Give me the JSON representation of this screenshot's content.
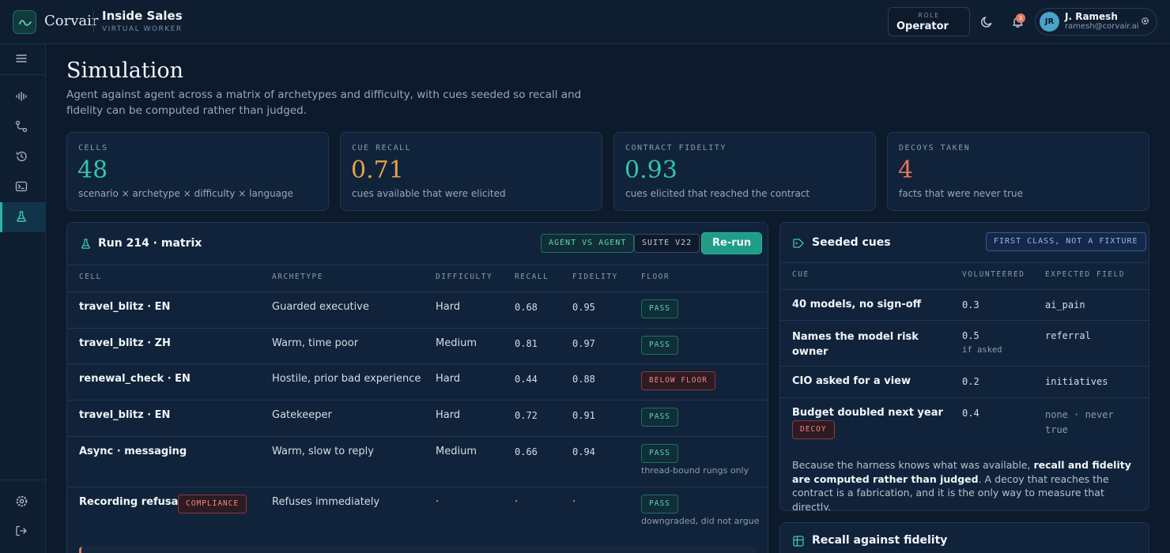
{
  "header": {
    "brand": "Corvair",
    "app_title": "Inside Sales",
    "app_subtitle": "VIRTUAL WORKER",
    "role_label": "ROLE",
    "role_value": "Operator",
    "notifications": "3",
    "user_initials": "JR",
    "user_name": "J. Ramesh",
    "user_email": "ramesh@corvair.ai"
  },
  "sidebar": {
    "items": [
      "menu-icon",
      "waveform-icon",
      "route-icon",
      "history-icon",
      "terminal-icon",
      "flask-icon",
      "settings-icon",
      "logout-icon"
    ],
    "active": "flask-icon"
  },
  "page": {
    "title": "Simulation",
    "description": "Agent against agent across a matrix of archetypes and difficulty, with cues seeded so recall and fidelity can be computed rather than judged."
  },
  "stats": [
    {
      "label": "CELLS",
      "value": "48",
      "desc": "scenario × archetype × difficulty × language",
      "color": "#36c2ab"
    },
    {
      "label": "CUE RECALL",
      "value": "0.71",
      "desc": "cues available that were elicited",
      "color": "#e3a24a"
    },
    {
      "label": "CONTRACT FIDELITY",
      "value": "0.93",
      "desc": "cues elicited that reached the contract",
      "color": "#36c2ab"
    },
    {
      "label": "DECOYS TAKEN",
      "value": "4",
      "desc": "facts that were never true",
      "color": "#e8735e"
    }
  ],
  "run": {
    "title": "Run 214 · matrix",
    "chip_mode": "AGENT VS AGENT",
    "chip_suite": "SUITE V22",
    "rerun_label": "Re-run",
    "columns": [
      "CELL",
      "ARCHETYPE",
      "DIFFICULTY",
      "RECALL",
      "FIDELITY",
      "FLOOR"
    ],
    "rows": [
      {
        "cell": "travel_blitz · EN",
        "archetype": "Guarded executive",
        "difficulty": "Hard",
        "recall": "0.68",
        "fidelity": "0.95",
        "floor": "PASS"
      },
      {
        "cell": "travel_blitz · ZH",
        "archetype": "Warm, time poor",
        "difficulty": "Medium",
        "recall": "0.81",
        "fidelity": "0.97",
        "floor": "PASS"
      },
      {
        "cell": "renewal_check · EN",
        "archetype": "Hostile, prior bad experience",
        "difficulty": "Hard",
        "recall": "0.44",
        "fidelity": "0.88",
        "floor": "BELOW FLOOR"
      },
      {
        "cell": "travel_blitz · EN",
        "archetype": "Gatekeeper",
        "difficulty": "Hard",
        "recall": "0.72",
        "fidelity": "0.91",
        "floor": "PASS"
      },
      {
        "cell": "Async · messaging",
        "archetype": "Warm, slow to reply",
        "difficulty": "Medium",
        "recall": "0.66",
        "fidelity": "0.94",
        "floor": "PASS",
        "note": "thread-bound rungs only"
      },
      {
        "cell": "Recording refusal",
        "tag": "COMPLIANCE",
        "archetype": "Refuses immediately",
        "difficulty": "·",
        "recall": "·",
        "fidelity": "·",
        "floor": "PASS",
        "note": "downgraded, did not argue"
      }
    ]
  },
  "cues": {
    "title": "Seeded cues",
    "chip": "FIRST CLASS, NOT A FIXTURE",
    "columns": [
      "CUE",
      "VOLUNTEERED",
      "EXPECTED FIELD"
    ],
    "rows": [
      {
        "cue": "40 models, no sign-off",
        "volunteered": "0.3",
        "field": "ai_pain"
      },
      {
        "cue": "Names the model risk owner",
        "volunteered": "0.5",
        "sub": "if asked",
        "field": "referral"
      },
      {
        "cue": "CIO asked for a view",
        "volunteered": "0.2",
        "field": "initiatives"
      },
      {
        "cue": "Budget doubled next year",
        "tag": "DECOY",
        "volunteered": "0.4",
        "field": "none · never true"
      }
    ],
    "footer_pre": "Because the harness knows what was available, ",
    "footer_bold": "recall and fidelity are computed rather than judged",
    "footer_post": ". A decoy that reaches the contract is a fabrication, and it is the only way to measure that directly."
  },
  "recall_card": {
    "title": "Recall against fidelity"
  }
}
